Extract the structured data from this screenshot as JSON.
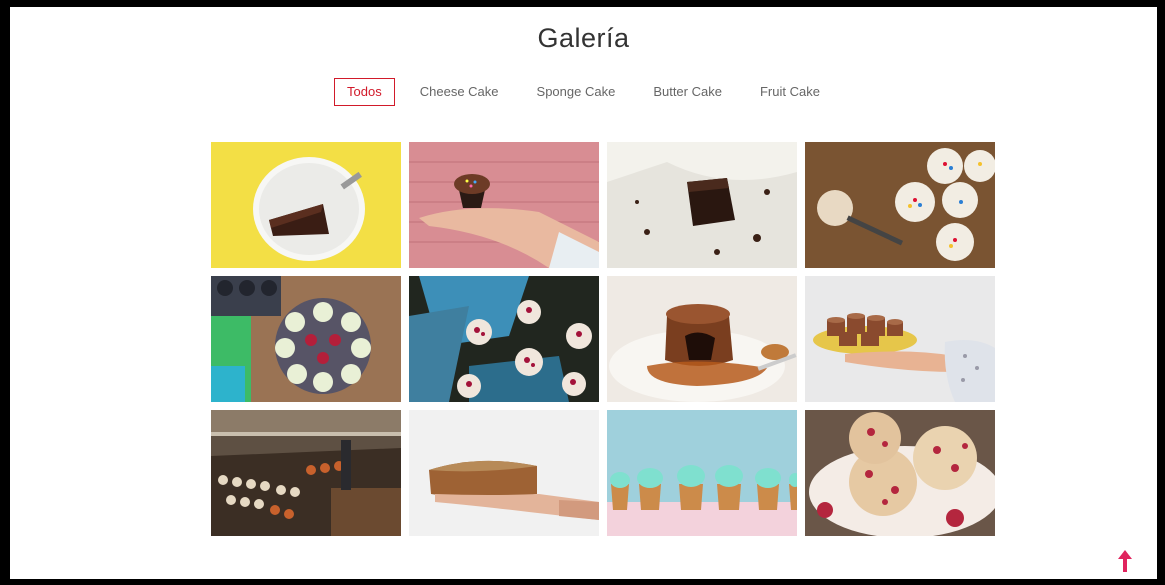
{
  "page": {
    "title": "Galería"
  },
  "filters": [
    {
      "label": "Todos",
      "active": true
    },
    {
      "label": "Cheese Cake",
      "active": false
    },
    {
      "label": "Sponge Cake",
      "active": false
    },
    {
      "label": "Butter Cake",
      "active": false
    },
    {
      "label": "Fruit Cake",
      "active": false
    }
  ],
  "gallery": {
    "items": [
      {
        "subject": "chocolate cake slice on white plate, yellow background"
      },
      {
        "subject": "hand holding cupcake with sprinkles, pink brick wall"
      },
      {
        "subject": "chocolate brownie on white frosting"
      },
      {
        "subject": "cupcakes with colorful sprinkles and fork on wood"
      },
      {
        "subject": "cupcakes with cream on tray, muffin pan"
      },
      {
        "subject": "cupcakes with red toppings on blue cloth"
      },
      {
        "subject": "chocolate lava cake with caramel sauce"
      },
      {
        "subject": "hand holding plate of chocolate muffins"
      },
      {
        "subject": "bakery display with many pastries"
      },
      {
        "subject": "hand holding pound cake"
      },
      {
        "subject": "row of mint frosted cupcakes"
      },
      {
        "subject": "raspberry muffins on floral plate"
      }
    ]
  },
  "colors": {
    "accent": "#d11a2a",
    "scroll_top": "#e0245e"
  },
  "icons": {
    "scroll_top": "arrow-up-icon"
  }
}
